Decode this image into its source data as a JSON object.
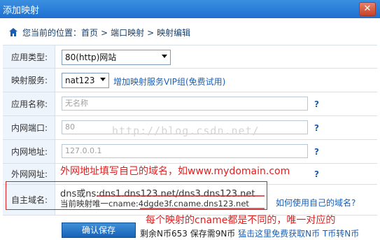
{
  "window": {
    "title": "添加映射",
    "close_glyph": "✕"
  },
  "breadcrumb": {
    "prefix": "您当前的位置：",
    "items": [
      "首页",
      "端口映射",
      "映射编辑"
    ],
    "separator": ">"
  },
  "fields": {
    "app_type": {
      "label": "应用类型:",
      "value": "80(http)网站"
    },
    "service": {
      "label": "映射服务:",
      "value": "nat123",
      "link": "增加映射服务VIP组(免费试用)"
    },
    "app_name": {
      "label": "应用名称:",
      "placeholder": "无名称",
      "help": "?"
    },
    "port": {
      "label": "内网端口:",
      "value": "80",
      "help": "?"
    },
    "addr": {
      "label": "内网地址:",
      "value": "127.0.0.1",
      "help": "?"
    },
    "ext_addr": {
      "label": "外网网址:",
      "help": "?"
    },
    "domain": {
      "label": "自主域名:",
      "dns_line": "dns或ns:dns1.dns123.net/dns3.dns123.net",
      "cname_line": "当前映射唯一cname:4dgde3f.cname.dns123.net",
      "link": "如何使用自己的域名?"
    }
  },
  "annotations": {
    "ext_hint": "外网地址填写自己的域名，如www.mydomain.com",
    "cname_hint": "每个映射的cname都是不同的，唯一对应的"
  },
  "watermark": "http://blog.csdn.net/",
  "footer": {
    "save_button": "确认保存",
    "balance_text": "剩余N币653 保存需9N币",
    "earn_link": "猛击这里免费获取N币",
    "transfer_link": "T币转N币"
  },
  "colors": {
    "accent": "#1a5fb4",
    "annotation": "#e02020",
    "title_bar": "#1e6fd0"
  }
}
